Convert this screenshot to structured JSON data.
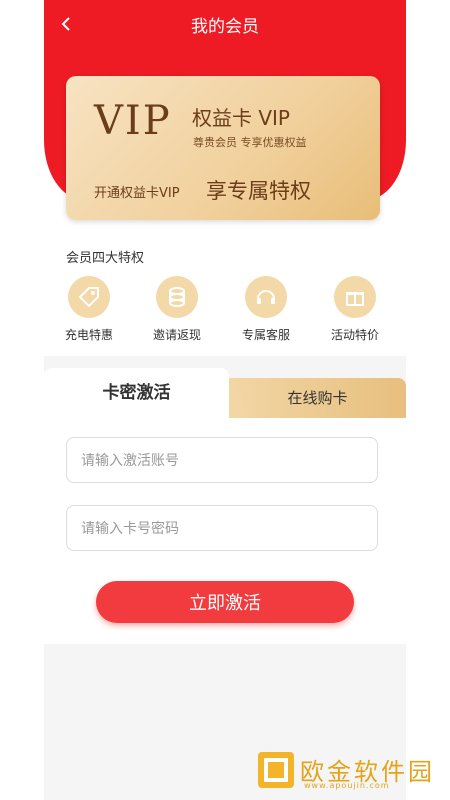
{
  "header": {
    "title": "我的会员",
    "back_icon": "chevron-left-icon"
  },
  "vip_card": {
    "logo": "VIP",
    "title": "权益卡 VIP",
    "desc": "尊贵会员  专享优惠权益",
    "open_text": "开通权益卡VIP",
    "privilege_text": "享专属特权"
  },
  "perks": {
    "title": "会员四大特权",
    "items": [
      {
        "label": "充电特惠",
        "icon": "tag-icon"
      },
      {
        "label": "邀请返现",
        "icon": "coins-icon"
      },
      {
        "label": "专属客服",
        "icon": "headset-icon"
      },
      {
        "label": "活动特价",
        "icon": "gift-icon"
      }
    ]
  },
  "tabs": {
    "active": "卡密激活",
    "inactive": "在线购卡"
  },
  "form": {
    "account_placeholder": "请输入激活账号",
    "password_placeholder": "请输入卡号密码",
    "submit_label": "立即激活"
  },
  "watermark": {
    "text": "欧金软件园",
    "url": "www.apoujin.com"
  },
  "colors": {
    "brand_red": "#ee1b24",
    "gold": "#f1d09c",
    "button_red": "#f13b3f"
  }
}
